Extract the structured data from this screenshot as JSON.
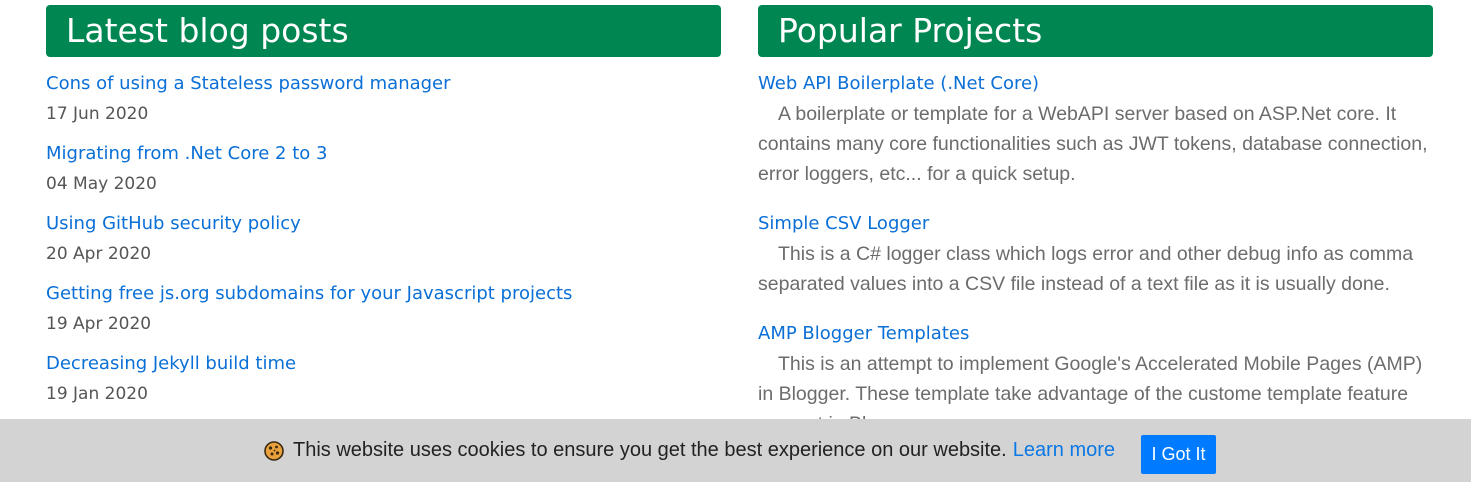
{
  "blog": {
    "heading": "Latest blog posts",
    "posts": [
      {
        "title": "Cons of using a Stateless password manager",
        "date": "17 Jun 2020"
      },
      {
        "title": "Migrating from .Net Core 2 to 3",
        "date": "04 May 2020"
      },
      {
        "title": "Using GitHub security policy",
        "date": "20 Apr 2020"
      },
      {
        "title": "Getting free js.org subdomains for your Javascript projects",
        "date": "19 Apr 2020"
      },
      {
        "title": "Decreasing Jekyll build time",
        "date": "19 Jan 2020"
      }
    ]
  },
  "projects": {
    "heading": "Popular Projects",
    "items": [
      {
        "title": "Web API Boilerplate (.Net Core)",
        "description": "A boilerplate or template for a WebAPI server based on ASP.Net core. It contains many core functionalities such as JWT tokens, database connection, error loggers, etc... for a quick setup."
      },
      {
        "title": "Simple CSV Logger",
        "description": "This is a C# logger class which logs error and other debug info as comma separated values into a CSV file instead of a text file as it is usually done."
      },
      {
        "title": "AMP Blogger Templates",
        "description": "This is an attempt to implement Google's Accelerated Mobile Pages (AMP) in Blogger. These template take advantage of the custome template feature present in Blogger."
      }
    ]
  },
  "cookie_notice": {
    "icon": "cookie-icon",
    "message": "This website uses cookies to ensure you get the best experience on our website.",
    "learn_more": "Learn more",
    "accept_label": "I Got It"
  },
  "colors": {
    "header_green": "#008751",
    "link_blue": "#0a6fd6",
    "button_blue": "#007bff",
    "cookie_bar_bg": "#d3d3d4"
  }
}
